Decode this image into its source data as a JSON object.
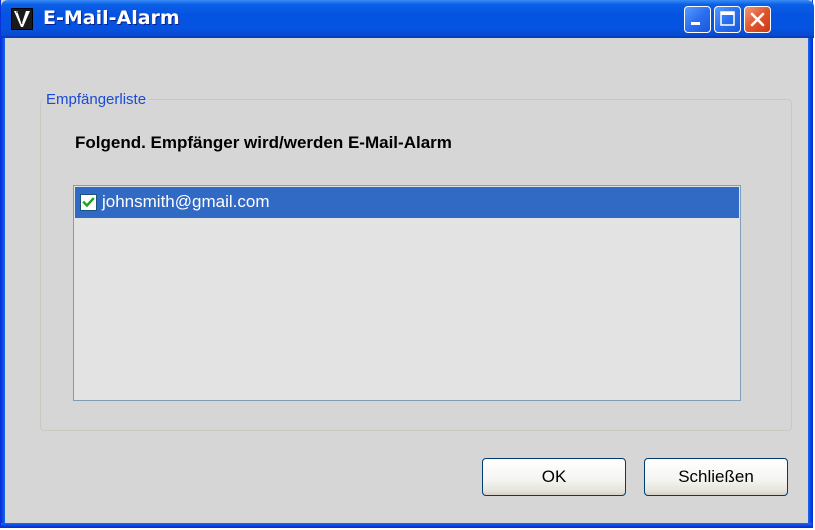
{
  "window": {
    "title": "E-Mail-Alarm",
    "title_bar_color": "#0553e1"
  },
  "groupbox": {
    "legend": "Empfängerliste",
    "instruction": "Folgend. Empfänger wird/werden E-Mail-Alarm"
  },
  "recipients": [
    {
      "email": "johnsmith@gmail.com",
      "checked": true,
      "selected": true
    }
  ],
  "buttons": {
    "ok_label": "OK",
    "close_label": "Schließen"
  },
  "colors": {
    "selection": "#316ac5",
    "legend_text": "#1a4ad6",
    "close_button": "#e0552c"
  },
  "icons": {
    "app": "app-logo-icon",
    "minimize": "minimize-icon",
    "maximize": "maximize-icon",
    "close": "close-icon",
    "checkbox": "checkmark-icon"
  }
}
